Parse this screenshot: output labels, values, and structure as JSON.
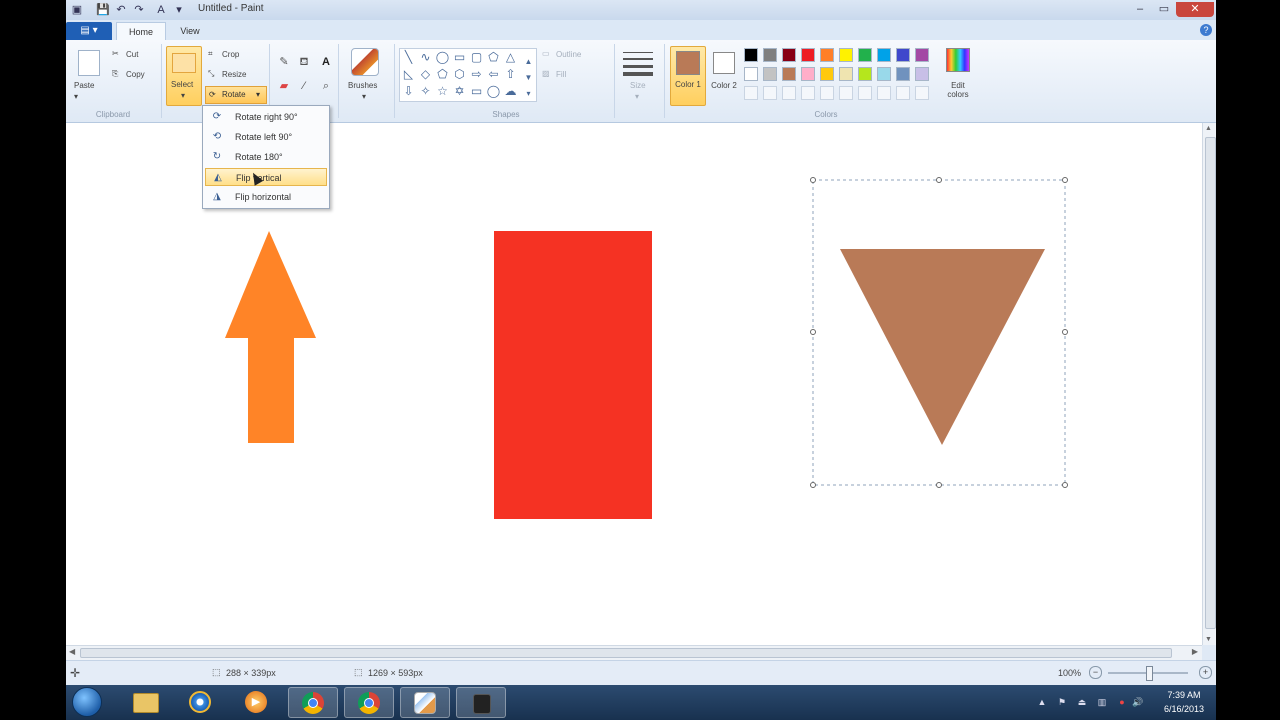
{
  "title": "Untitled - Paint",
  "tabs": {
    "file": "",
    "home": "Home",
    "view": "View"
  },
  "clipboard": {
    "paste": "Paste",
    "cut": "Cut",
    "copy": "Copy",
    "label": "Clipboard"
  },
  "image": {
    "select": "Select",
    "crop": "Crop",
    "resize": "Resize",
    "rotate": "Rotate"
  },
  "tools": {
    "brushes": "Brushes"
  },
  "shapes": {
    "outline": "Outline",
    "fill": "Fill",
    "label": "Shapes"
  },
  "size": {
    "label": "Size"
  },
  "colors": {
    "color1": "Color 1",
    "color2": "Color 2",
    "edit": "Edit colors",
    "label": "Colors",
    "row1": [
      "#000000",
      "#7f7f7f",
      "#880015",
      "#ed1c24",
      "#ff7f27",
      "#fff200",
      "#22b14c",
      "#00a2e8",
      "#3f48cc",
      "#a349a4"
    ],
    "row2": [
      "#ffffff",
      "#c3c3c3",
      "#b97a57",
      "#ffaec9",
      "#ffc90e",
      "#efe4b0",
      "#b5e61d",
      "#99d9ea",
      "#7092be",
      "#c8bfe7"
    ],
    "color1_value": "#b97a57",
    "color2_value": "#ffffff"
  },
  "rotate_menu": {
    "items": [
      {
        "label": "Rotate right 90°",
        "icon": "rotate-right-icon"
      },
      {
        "label": "Rotate left 90°",
        "icon": "rotate-left-icon"
      },
      {
        "label": "Rotate 180°",
        "icon": "rotate-180-icon"
      },
      {
        "label": "Flip vertical",
        "icon": "flip-vertical-icon"
      },
      {
        "label": "Flip horizontal",
        "icon": "flip-horizontal-icon"
      }
    ],
    "highlighted_index": 3
  },
  "canvas": {
    "arrow_color": "#ff8427",
    "rect_color": "#f53223",
    "triangle_color": "#b97a57"
  },
  "status": {
    "selection_size": "288 × 339px",
    "canvas_size": "1269 × 593px",
    "zoom": "100%"
  },
  "taskbar": {
    "time": "7:39 AM",
    "date": "6/16/2013"
  }
}
